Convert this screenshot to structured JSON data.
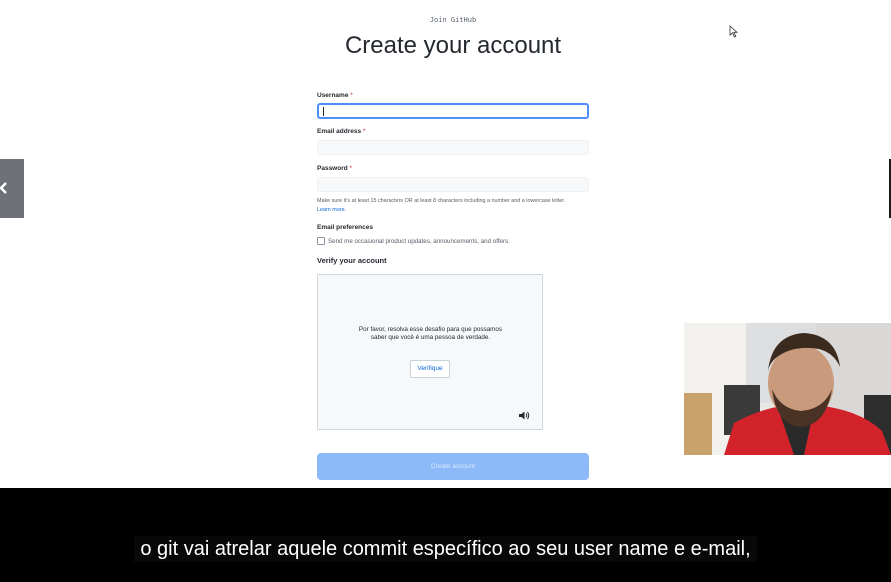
{
  "page": {
    "kicker": "Join GitHub",
    "title": "Create your account"
  },
  "form": {
    "username_label": "Username",
    "email_label": "Email address",
    "password_label": "Password",
    "required_mark": "*",
    "password_hint": "Make sure it's at least 15 characters OR at least 8 characters including a number and a lowercase letter.",
    "learn_more": "Learn more.",
    "email_prefs_label": "Email preferences",
    "email_prefs_option": "Send me occasional product updates, announcements, and offers.",
    "verify_title": "Verify your account",
    "submit_label": "Create account"
  },
  "captcha": {
    "text": "Por favor, resolva esse desafio para que possamos saber que você é uma pessoa de verdade.",
    "button_label": "Verifique",
    "audio_icon": "speaker-icon"
  },
  "video": {
    "caption": "o git vai atrelar aquele commit específico ao seu user name e e-mail,"
  },
  "colors": {
    "accent_blue": "#4f8ff7",
    "submit_disabled": "#8cb9f7",
    "required_red": "#cf222e",
    "caption_bg": "#000000"
  }
}
